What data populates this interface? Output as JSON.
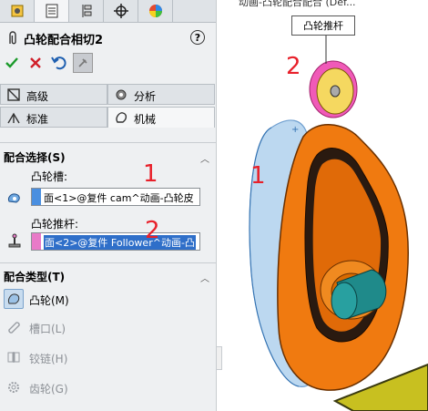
{
  "panel": {
    "title": "凸轮配合相切2",
    "help": "?",
    "tabs_top": [
      "feature-manager",
      "property-manager",
      "configuration-manager",
      "dimxpert",
      "display-manager"
    ],
    "tab_mid": [
      {
        "label": "高级",
        "icon": "advanced-mates-icon"
      },
      {
        "label": "分析",
        "icon": "analysis-gear-icon"
      }
    ],
    "tab_bottom": [
      {
        "label": "标准",
        "icon": "standard-mates-icon"
      },
      {
        "label": "机械",
        "icon": "mechanical-mates-icon"
      }
    ]
  },
  "mate_selections": {
    "header": "配合选择(S)",
    "cam_slot_label": "凸轮槽:",
    "cam_slot_value": "面<1>@复件 cam^动画-凸轮皮",
    "cam_follower_label": "凸轮推杆:",
    "cam_follower_value": "面<2>@复件 Follower^动画-凸"
  },
  "mate_types": {
    "header": "配合类型(T)",
    "items": [
      {
        "label": "凸轮(M)",
        "icon": "cam-icon",
        "selected": true
      },
      {
        "label": "槽口(L)",
        "icon": "slot-icon",
        "selected": false
      },
      {
        "label": "铰链(H)",
        "icon": "hinge-icon",
        "selected": false
      },
      {
        "label": "齿轮(G)",
        "icon": "gear-icon",
        "selected": false
      }
    ]
  },
  "annotations": {
    "n1": "1",
    "n2": "2"
  },
  "viewport": {
    "tooltip": "凸轮推杆",
    "top_title": "动画-凸轮配合配合 (Def..."
  },
  "colors": {
    "cam_orange": "#f07a10",
    "follower_teal": "#1f8a8a",
    "highlight_blue": "#bcd8f0",
    "annotation_red": "#e8202a",
    "swatch_blue": "#4a8fe0",
    "swatch_pink": "#e87ac8"
  }
}
